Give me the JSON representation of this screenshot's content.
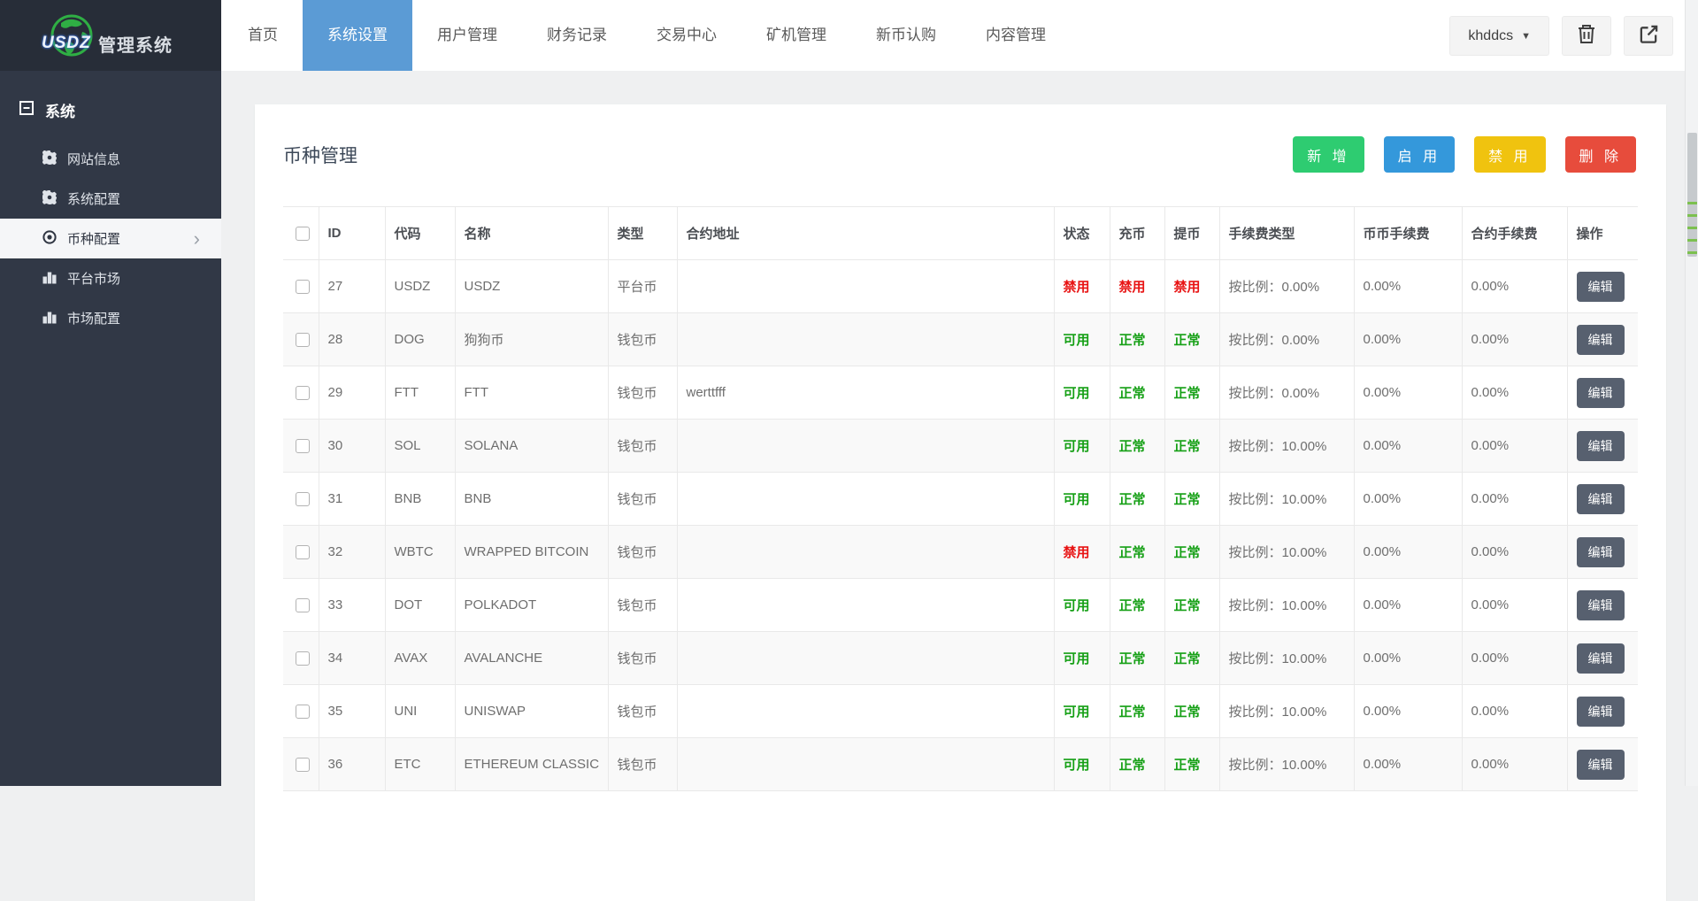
{
  "topbar": {
    "brand": "USDZ",
    "brand_suffix": "管理系统",
    "nav": [
      {
        "label": "首页",
        "active": false
      },
      {
        "label": "系统设置",
        "active": true
      },
      {
        "label": "用户管理",
        "active": false
      },
      {
        "label": "财务记录",
        "active": false
      },
      {
        "label": "交易中心",
        "active": false
      },
      {
        "label": "矿机管理",
        "active": false
      },
      {
        "label": "新币认购",
        "active": false
      },
      {
        "label": "内容管理",
        "active": false
      }
    ],
    "username": "khddcs"
  },
  "sidebar": {
    "section_label": "系统",
    "items": [
      {
        "label": "网站信息",
        "icon": "gear-icon",
        "active": false
      },
      {
        "label": "系统配置",
        "icon": "gear-icon",
        "active": false
      },
      {
        "label": "币种配置",
        "icon": "target-icon",
        "active": true
      },
      {
        "label": "平台市场",
        "icon": "bar-chart-icon",
        "active": false
      },
      {
        "label": "市场配置",
        "icon": "bar-chart-icon",
        "active": false
      }
    ]
  },
  "page": {
    "title": "币种管理",
    "actions": [
      {
        "label": "新 增",
        "color": "#2ecc71"
      },
      {
        "label": "启 用",
        "color": "#3498db"
      },
      {
        "label": "禁 用",
        "color": "#f0c30f"
      },
      {
        "label": "删 除",
        "color": "#e74c3c"
      }
    ]
  },
  "table": {
    "columns": {
      "id": "ID",
      "code": "代码",
      "name": "名称",
      "type": "类型",
      "contract": "合约地址",
      "status": "状态",
      "deposit": "充币",
      "withdraw": "提币",
      "fee_type": "手续费类型",
      "coin_fee": "币币手续费",
      "contract_fee": "合约手续费",
      "op": "操作"
    },
    "edit_label": "编辑",
    "rows": [
      {
        "id": "27",
        "code": "USDZ",
        "name": "USDZ",
        "type": "平台币",
        "contract": "",
        "status": {
          "text": "禁用",
          "color": "#e81414"
        },
        "deposit": {
          "text": "禁用",
          "color": "#e81414"
        },
        "withdraw": {
          "text": "禁用",
          "color": "#e81414"
        },
        "fee_type": "按比例：0.00%",
        "coin_fee": "0.00%",
        "contract_fee": "0.00%"
      },
      {
        "id": "28",
        "code": "DOG",
        "name": "狗狗币",
        "type": "钱包币",
        "contract": "",
        "status": {
          "text": "可用",
          "color": "#16a016"
        },
        "deposit": {
          "text": "正常",
          "color": "#16a016"
        },
        "withdraw": {
          "text": "正常",
          "color": "#16a016"
        },
        "fee_type": "按比例：0.00%",
        "coin_fee": "0.00%",
        "contract_fee": "0.00%"
      },
      {
        "id": "29",
        "code": "FTT",
        "name": "FTT",
        "type": "钱包币",
        "contract": "werttfff",
        "status": {
          "text": "可用",
          "color": "#16a016"
        },
        "deposit": {
          "text": "正常",
          "color": "#16a016"
        },
        "withdraw": {
          "text": "正常",
          "color": "#16a016"
        },
        "fee_type": "按比例：0.00%",
        "coin_fee": "0.00%",
        "contract_fee": "0.00%"
      },
      {
        "id": "30",
        "code": "SOL",
        "name": "SOLANA",
        "type": "钱包币",
        "contract": "",
        "status": {
          "text": "可用",
          "color": "#16a016"
        },
        "deposit": {
          "text": "正常",
          "color": "#16a016"
        },
        "withdraw": {
          "text": "正常",
          "color": "#16a016"
        },
        "fee_type": "按比例：10.00%",
        "coin_fee": "0.00%",
        "contract_fee": "0.00%"
      },
      {
        "id": "31",
        "code": "BNB",
        "name": "BNB",
        "type": "钱包币",
        "contract": "",
        "status": {
          "text": "可用",
          "color": "#16a016"
        },
        "deposit": {
          "text": "正常",
          "color": "#16a016"
        },
        "withdraw": {
          "text": "正常",
          "color": "#16a016"
        },
        "fee_type": "按比例：10.00%",
        "coin_fee": "0.00%",
        "contract_fee": "0.00%"
      },
      {
        "id": "32",
        "code": "WBTC",
        "name": "WRAPPED BITCOIN",
        "type": "钱包币",
        "contract": "",
        "status": {
          "text": "禁用",
          "color": "#e81414"
        },
        "deposit": {
          "text": "正常",
          "color": "#16a016"
        },
        "withdraw": {
          "text": "正常",
          "color": "#16a016"
        },
        "fee_type": "按比例：10.00%",
        "coin_fee": "0.00%",
        "contract_fee": "0.00%"
      },
      {
        "id": "33",
        "code": "DOT",
        "name": "POLKADOT",
        "type": "钱包币",
        "contract": "",
        "status": {
          "text": "可用",
          "color": "#16a016"
        },
        "deposit": {
          "text": "正常",
          "color": "#16a016"
        },
        "withdraw": {
          "text": "正常",
          "color": "#16a016"
        },
        "fee_type": "按比例：10.00%",
        "coin_fee": "0.00%",
        "contract_fee": "0.00%"
      },
      {
        "id": "34",
        "code": "AVAX",
        "name": "AVALANCHE",
        "type": "钱包币",
        "contract": "",
        "status": {
          "text": "可用",
          "color": "#16a016"
        },
        "deposit": {
          "text": "正常",
          "color": "#16a016"
        },
        "withdraw": {
          "text": "正常",
          "color": "#16a016"
        },
        "fee_type": "按比例：10.00%",
        "coin_fee": "0.00%",
        "contract_fee": "0.00%"
      },
      {
        "id": "35",
        "code": "UNI",
        "name": "UNISWAP",
        "type": "钱包币",
        "contract": "",
        "status": {
          "text": "可用",
          "color": "#16a016"
        },
        "deposit": {
          "text": "正常",
          "color": "#16a016"
        },
        "withdraw": {
          "text": "正常",
          "color": "#16a016"
        },
        "fee_type": "按比例：10.00%",
        "coin_fee": "0.00%",
        "contract_fee": "0.00%"
      },
      {
        "id": "36",
        "code": "ETC",
        "name": "ETHEREUM CLASSIC",
        "type": "钱包币",
        "contract": "",
        "status": {
          "text": "可用",
          "color": "#16a016"
        },
        "deposit": {
          "text": "正常",
          "color": "#16a016"
        },
        "withdraw": {
          "text": "正常",
          "color": "#16a016"
        },
        "fee_type": "按比例：10.00%",
        "coin_fee": "0.00%",
        "contract_fee": "0.00%"
      }
    ]
  },
  "colors": {
    "nav_active_bg": "#5b9bd5",
    "sidebar_bg": "#313846",
    "edit_btn_bg": "#57606f",
    "status_red": "#e81414",
    "status_green": "#16a016"
  }
}
